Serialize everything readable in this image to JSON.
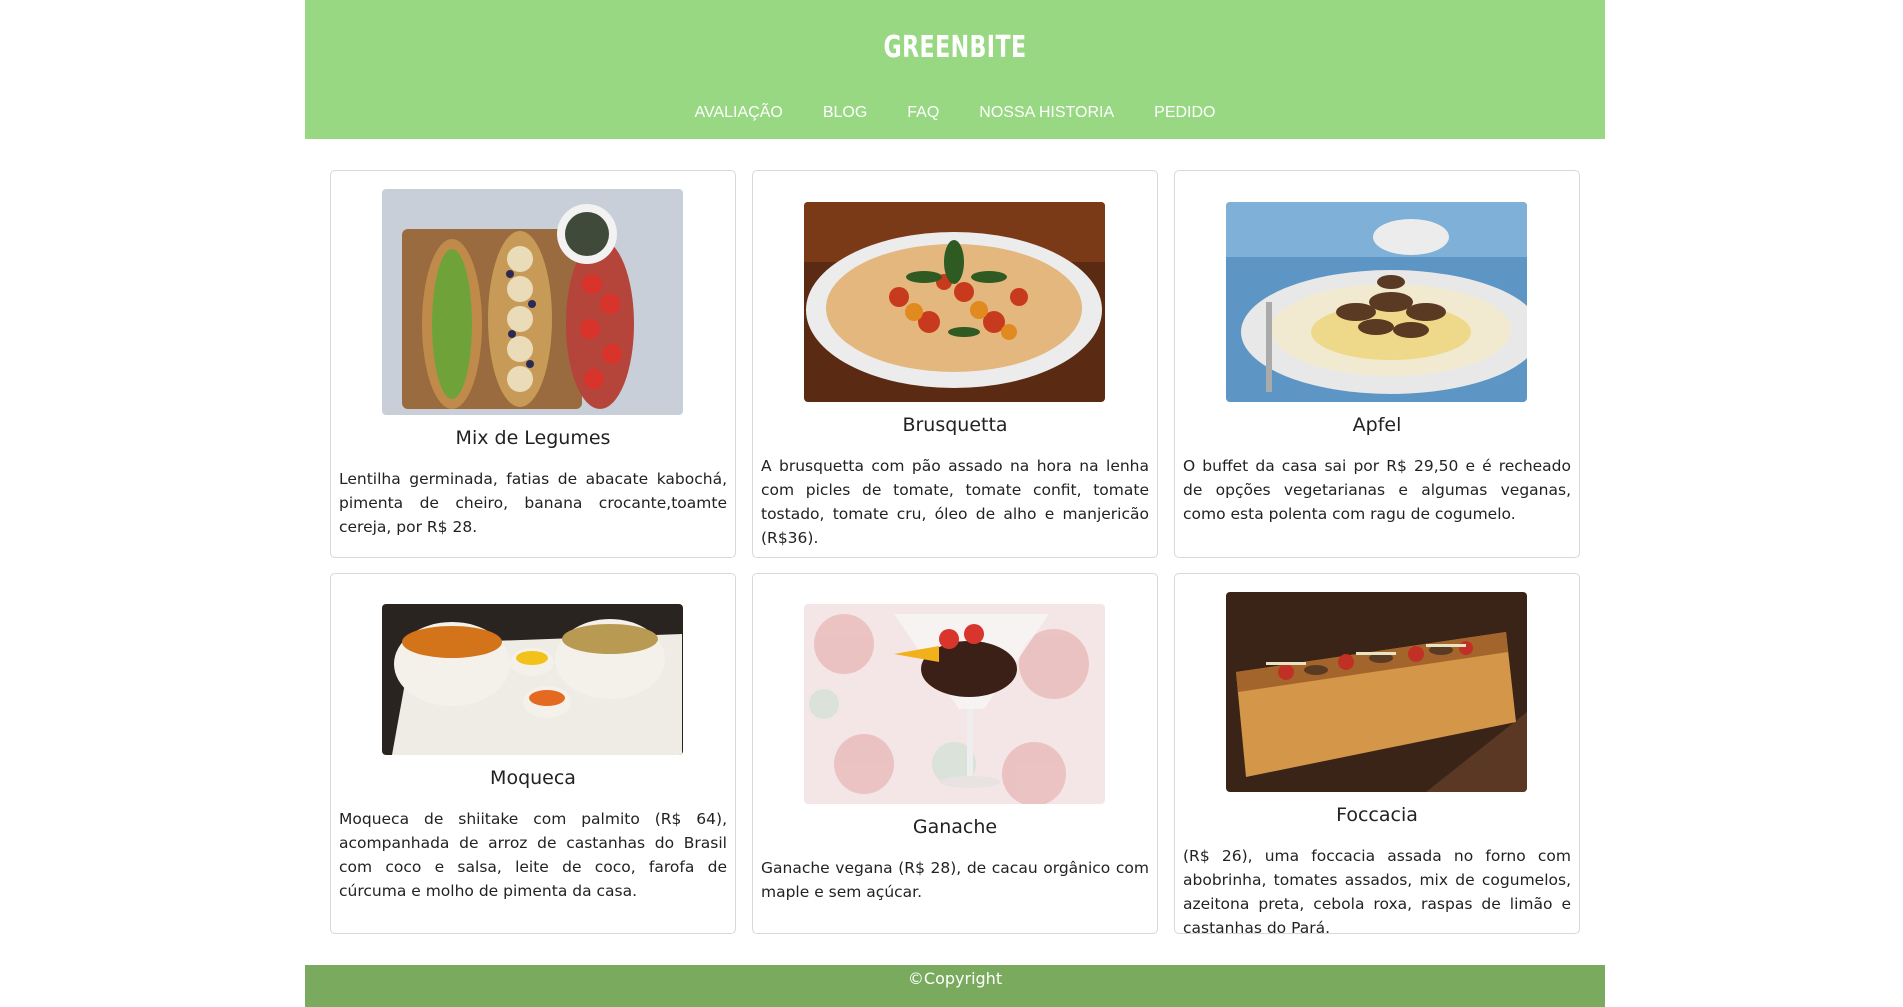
{
  "brand": "GREENBITE",
  "nav": [
    "AVALIAÇÃO",
    "BLOG",
    "FAQ",
    "NOSSA HISTORIA",
    "PEDIDO"
  ],
  "cards": [
    {
      "title": "Mix de Legumes",
      "desc": "Lentilha germinada, fatias de abacate kabochá, pimenta de cheiro, banana crocante,toamte cereja, por R$ 28."
    },
    {
      "title": "Brusquetta",
      "desc": "A brusquetta com pão assado na hora na lenha com picles de tomate, tomate confit, tomate tostado, tomate cru, óleo de alho e manjericão (R$36)."
    },
    {
      "title": "Apfel",
      "desc": "O buffet da casa sai por R$ 29,50 e é recheado de opções vegetarianas e algumas veganas, como esta polenta com ragu de cogumelo."
    },
    {
      "title": "Moqueca",
      "desc": "Moqueca de shiitake com palmito (R$ 64), acompanhada de arroz de castanhas do Brasil com coco e salsa, leite de coco, farofa de cúrcuma e molho de pimenta da casa."
    },
    {
      "title": "Ganache",
      "desc": "Ganache vegana (R$ 28), de cacau orgânico com maple e sem açúcar."
    },
    {
      "title": "Foccacia",
      "desc": "(R$ 26), uma foccacia assada no forno com abobrinha, tomates assados, mix de cogumelos, azeitona preta, cebola roxa, raspas de limão e castanhas do Pará."
    }
  ],
  "footer": "©Copyright",
  "colors": {
    "header": "#98d883",
    "footer": "#7aaa5e"
  }
}
